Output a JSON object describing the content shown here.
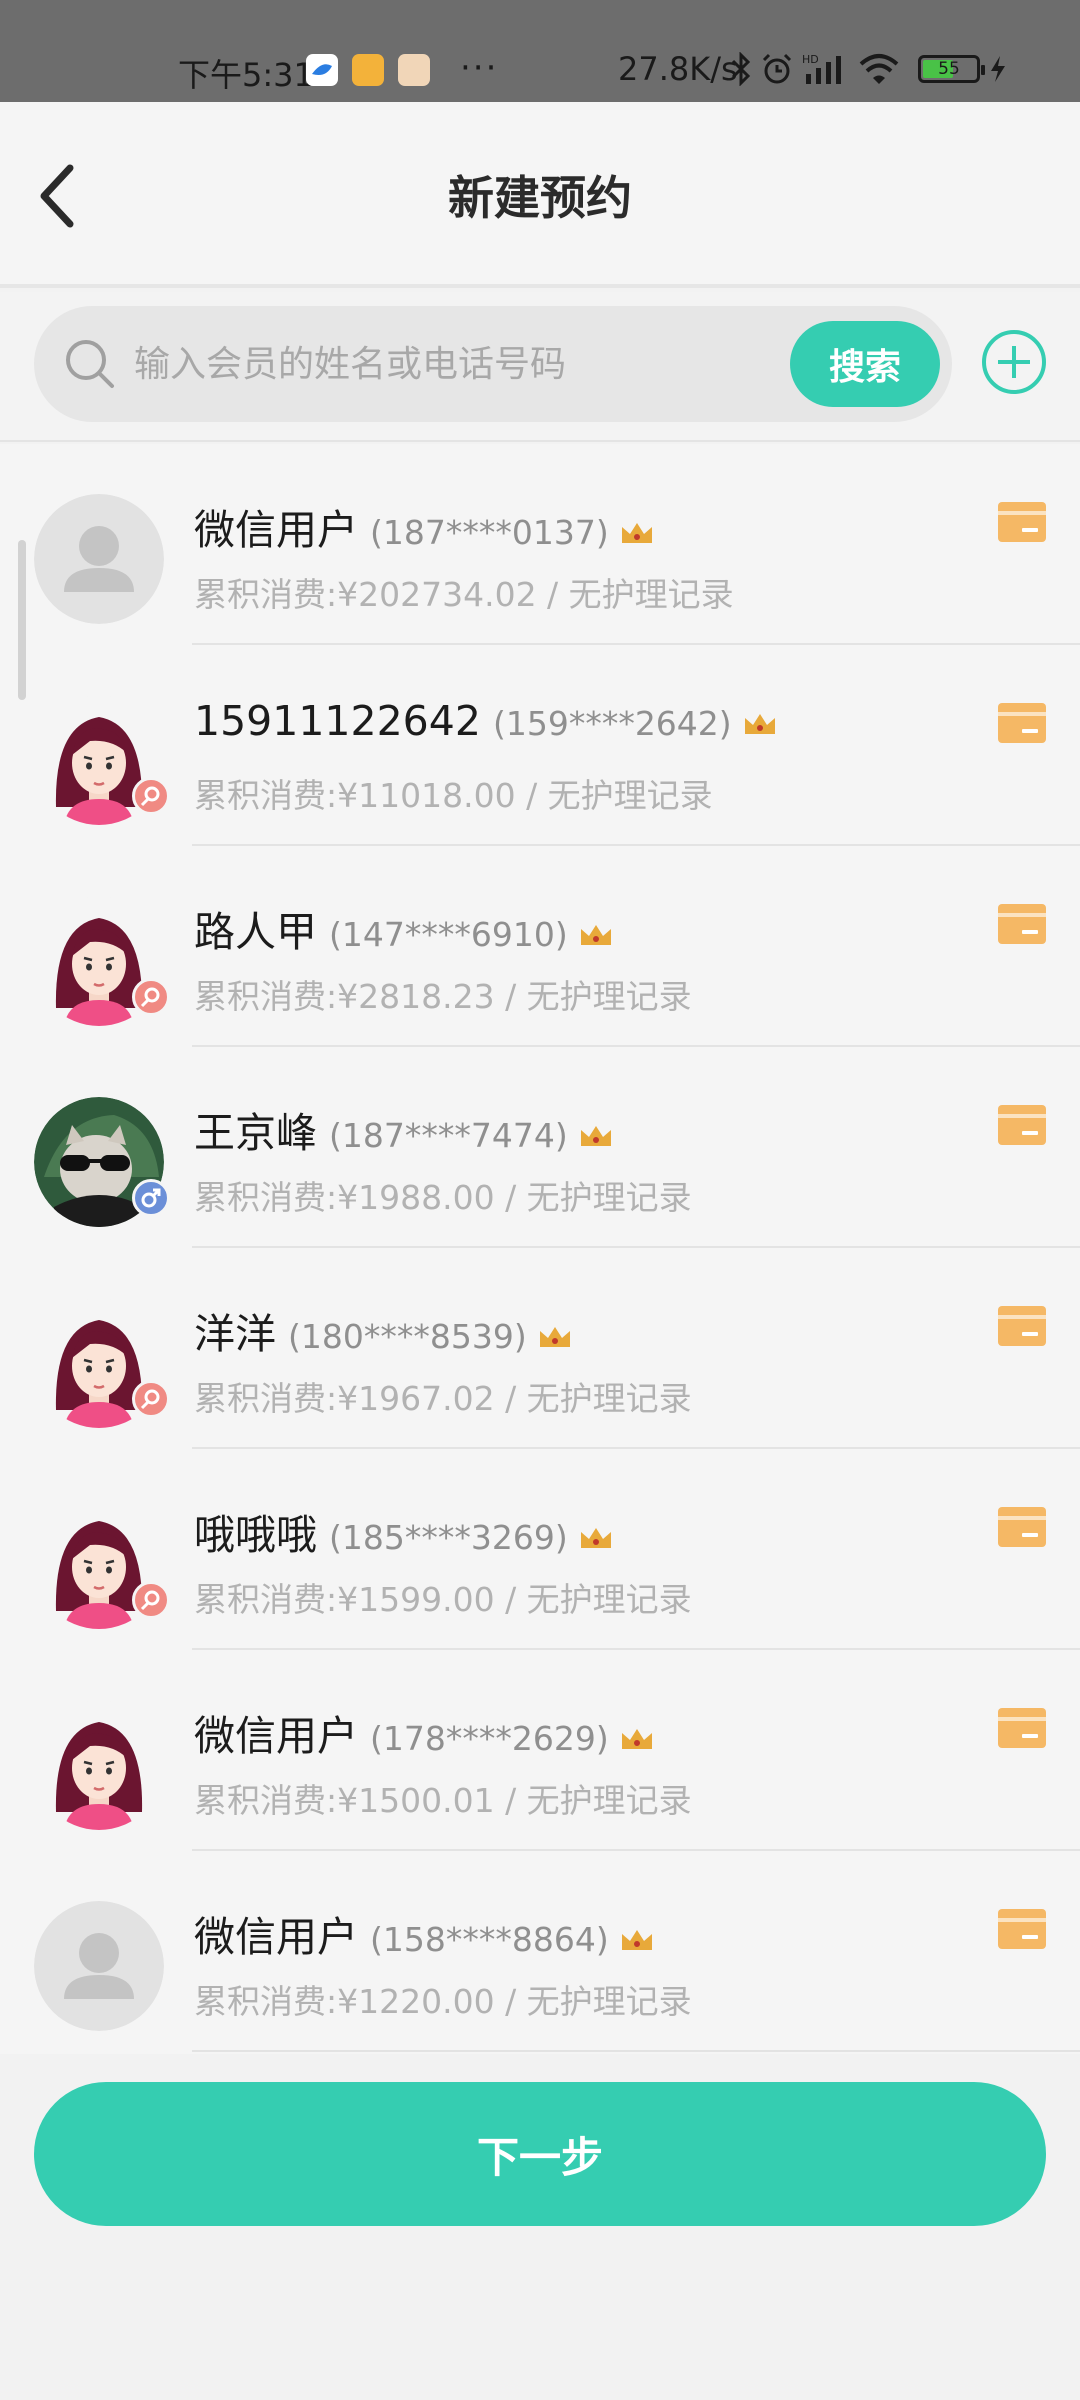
{
  "status_bar": {
    "time": "下午5:31",
    "network_speed": "27.8K/s",
    "signal_label": "HD",
    "battery_level": "55",
    "battery_fraction": 0.55
  },
  "header": {
    "title": "新建预约"
  },
  "search": {
    "placeholder": "输入会员的姓名或电话号码",
    "button_label": "搜索"
  },
  "members": [
    {
      "name": "微信用户",
      "phone": "(187****0137)",
      "summary": "累积消费:¥202734.02 / 无护理记录",
      "avatar": "default-avatar",
      "gender": "none"
    },
    {
      "name": "15911122642",
      "phone": "(159****2642)",
      "summary": "累积消费:¥11018.00 / 无护理记录",
      "avatar": "female-avatar",
      "gender": "female"
    },
    {
      "name": "路人甲",
      "phone": "(147****6910)",
      "summary": "累积消费:¥2818.23 / 无护理记录",
      "avatar": "female-avatar",
      "gender": "female"
    },
    {
      "name": "王京峰",
      "phone": "(187****7474)",
      "summary": "累积消费:¥1988.00 / 无护理记录",
      "avatar": "cat-photo-avatar",
      "gender": "male"
    },
    {
      "name": "洋洋",
      "phone": "(180****8539)",
      "summary": "累积消费:¥1967.02 / 无护理记录",
      "avatar": "female-avatar",
      "gender": "female"
    },
    {
      "name": "哦哦哦",
      "phone": "(185****3269)",
      "summary": "累积消费:¥1599.00 / 无护理记录",
      "avatar": "female-avatar",
      "gender": "female"
    },
    {
      "name": "微信用户",
      "phone": "(178****2629)",
      "summary": "累积消费:¥1500.01 / 无护理记录",
      "avatar": "female-avatar",
      "gender": "none"
    },
    {
      "name": "微信用户",
      "phone": "(158****8864)",
      "summary": "累积消费:¥1220.00 / 无护理记录",
      "avatar": "default-avatar",
      "gender": "none"
    }
  ],
  "footer": {
    "next_label": "下一步"
  },
  "colors": {
    "accent": "#35cdb1",
    "card_orange": "#f5b865",
    "crown_gold": "#e8a93a",
    "female_badge": "#f08a83",
    "male_badge": "#6b8fd8"
  }
}
